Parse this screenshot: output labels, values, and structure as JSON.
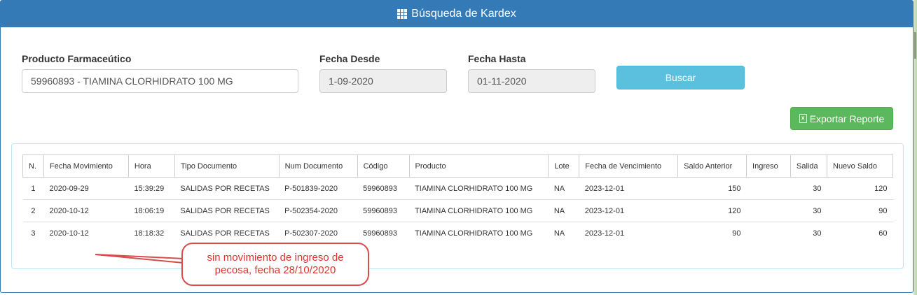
{
  "header": {
    "title": "Búsqueda de Kardex",
    "icon": "grid-icon"
  },
  "form": {
    "producto": {
      "label": "Producto Farmaceútico",
      "value": "59960893 - TIAMINA CLORHIDRATO 100 MG"
    },
    "fecha_desde": {
      "label": "Fecha Desde",
      "value": "1-09-2020"
    },
    "fecha_hasta": {
      "label": "Fecha Hasta",
      "value": "01-11-2020"
    },
    "buscar_label": "Buscar",
    "exportar_label": "Exportar Reporte"
  },
  "table": {
    "columns": [
      "N.",
      "Fecha Movimiento",
      "Hora",
      "Tipo Documento",
      "Num Documento",
      "Código",
      "Producto",
      "Lote",
      "Fecha de Vencimiento",
      "Saldo Anterior",
      "Ingreso",
      "Salida",
      "Nuevo Saldo"
    ],
    "rows": [
      [
        "1",
        "2020-09-29",
        "15:39:29",
        "SALIDAS POR RECETAS",
        "P-501839-2020",
        "59960893",
        "TIAMINA CLORHIDRATO 100 MG",
        "NA",
        "2023-12-01",
        "150",
        "",
        "30",
        "120"
      ],
      [
        "2",
        "2020-10-12",
        "18:06:19",
        "SALIDAS POR RECETAS",
        "P-502354-2020",
        "59960893",
        "TIAMINA CLORHIDRATO 100 MG",
        "NA",
        "2023-12-01",
        "120",
        "",
        "30",
        "90"
      ],
      [
        "3",
        "2020-10-12",
        "18:18:32",
        "SALIDAS POR RECETAS",
        "P-502307-2020",
        "59960893",
        "TIAMINA CLORHIDRATO 100 MG",
        "NA",
        "2023-12-01",
        "90",
        "",
        "30",
        "60"
      ]
    ]
  },
  "annotation": {
    "line1": "sin movimiento de ingreso de",
    "line2": "pecosa, fecha 28/10/2020"
  },
  "colors": {
    "header": "#337ab7",
    "buscar": "#5bc0de",
    "exportar": "#5cb85c",
    "annotation": "#d84c4c"
  }
}
